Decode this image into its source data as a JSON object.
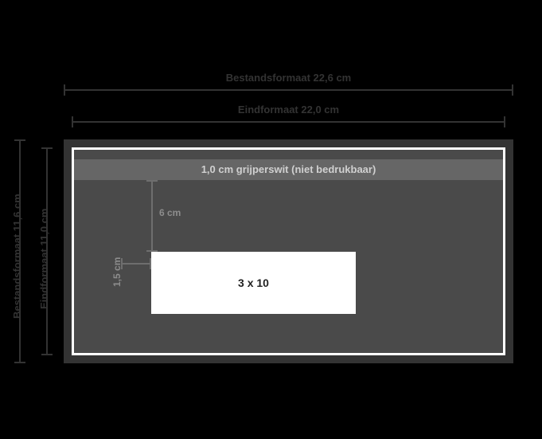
{
  "outer_width_label": "Bestandsformaat 22,6 cm",
  "final_width_label": "Eindformaat 22,0 cm",
  "outer_height_label": "Bestandsformaat 11,6 cm",
  "final_height_label": "Eindformaat 11,0 cm",
  "gripper_label": "1,0 cm grijperswit (niet bedrukbaar)",
  "window_label": "3 x 10",
  "inner_top_measure": "6 cm",
  "inner_left_measure": "1,5 cm",
  "dims": {
    "file_format_cm": [
      22.6,
      11.6
    ],
    "final_format_cm": [
      22.0,
      11.0
    ],
    "gripper_white_cm": 1.0,
    "window_cm": [
      10,
      3
    ],
    "window_offset_left_cm": 1.5,
    "window_offset_top_cm": 6
  }
}
